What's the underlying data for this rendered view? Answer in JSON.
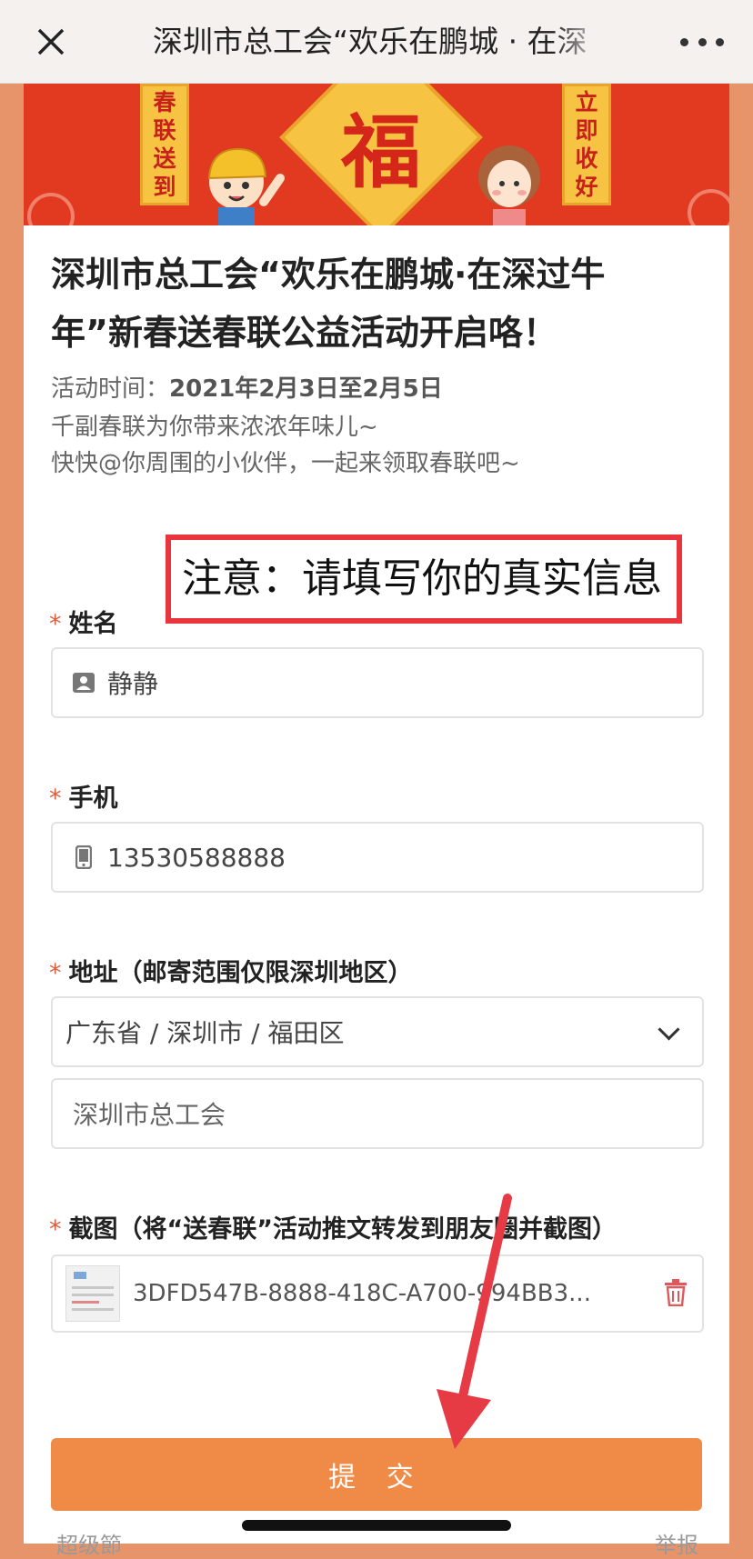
{
  "topbar": {
    "title": "深圳市总工会“欢乐在鹏城 · 在深",
    "close_icon": "close-icon",
    "more_icon": "more-dots-icon"
  },
  "banner": {
    "left_couplet": [
      "春",
      "联",
      "送",
      "到"
    ],
    "right_couplet": [
      "立",
      "即",
      "收",
      "好"
    ],
    "fu": "福",
    "colors": {
      "background": "#e13a21",
      "gold": "#f6c342"
    }
  },
  "content": {
    "headline": "深圳市总工会“欢乐在鹏城·在深过牛年”新春送春联公益活动开启咯！",
    "time_label": "活动时间：",
    "time_value": "2021年2月3日至2月5日",
    "line2": "千副春联为你带来浓浓年味儿~",
    "line3": "快快@你周围的小伙伴，一起来领取春联吧~"
  },
  "notice": "注意：请填写你的真实信息",
  "form": {
    "required_mark": "*",
    "name": {
      "label": "姓名",
      "value": "静静",
      "icon": "person-card-icon"
    },
    "phone": {
      "label": "手机",
      "value": "13530588888",
      "icon": "phone-icon"
    },
    "address": {
      "label": "地址（邮寄范围仅限深圳地区）",
      "region": "广东省 / 深圳市 / 福田区",
      "detail": "深圳市总工会"
    },
    "screenshot": {
      "label": "截图（将“送春联”活动推文转发到朋友圈并截图）",
      "filename": "3DFD547B-8888-418C-A700-994BB3...",
      "delete_icon": "trash-icon"
    },
    "submit": "提 交"
  },
  "footer": {
    "left": "超级節",
    "right": "举报"
  },
  "accent_colors": {
    "orange": "#ef8b46",
    "notice_red": "#e8353e",
    "arrow_red": "#e63a45"
  }
}
